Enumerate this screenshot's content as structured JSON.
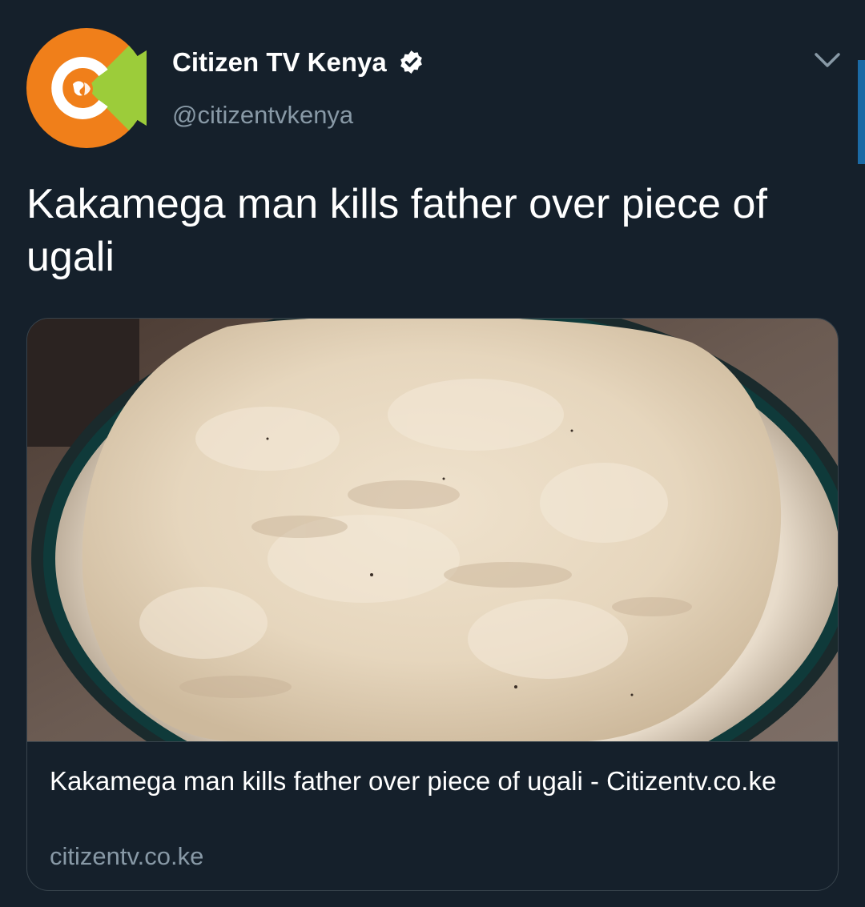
{
  "tweet": {
    "author": {
      "display_name": "Citizen TV Kenya",
      "handle": "@citizentvkenya",
      "verified": true,
      "avatar_icon": "citizen-tv-logo"
    },
    "text": "Kakamega man kills father over piece of ugali",
    "menu_icon": "chevron-down-icon"
  },
  "card": {
    "image_description_icon": "ugali-plate-image",
    "title": "Kakamega man kills father over piece of ugali - Citizentv.co.ke",
    "domain": "citizentv.co.ke"
  },
  "colors": {
    "background": "#15202b",
    "secondary_text": "#8899a6",
    "border": "#38444d",
    "logo_orange": "#f07f1a",
    "logo_green": "#9ccc3a",
    "accent_blue": "#1b6aa5"
  }
}
